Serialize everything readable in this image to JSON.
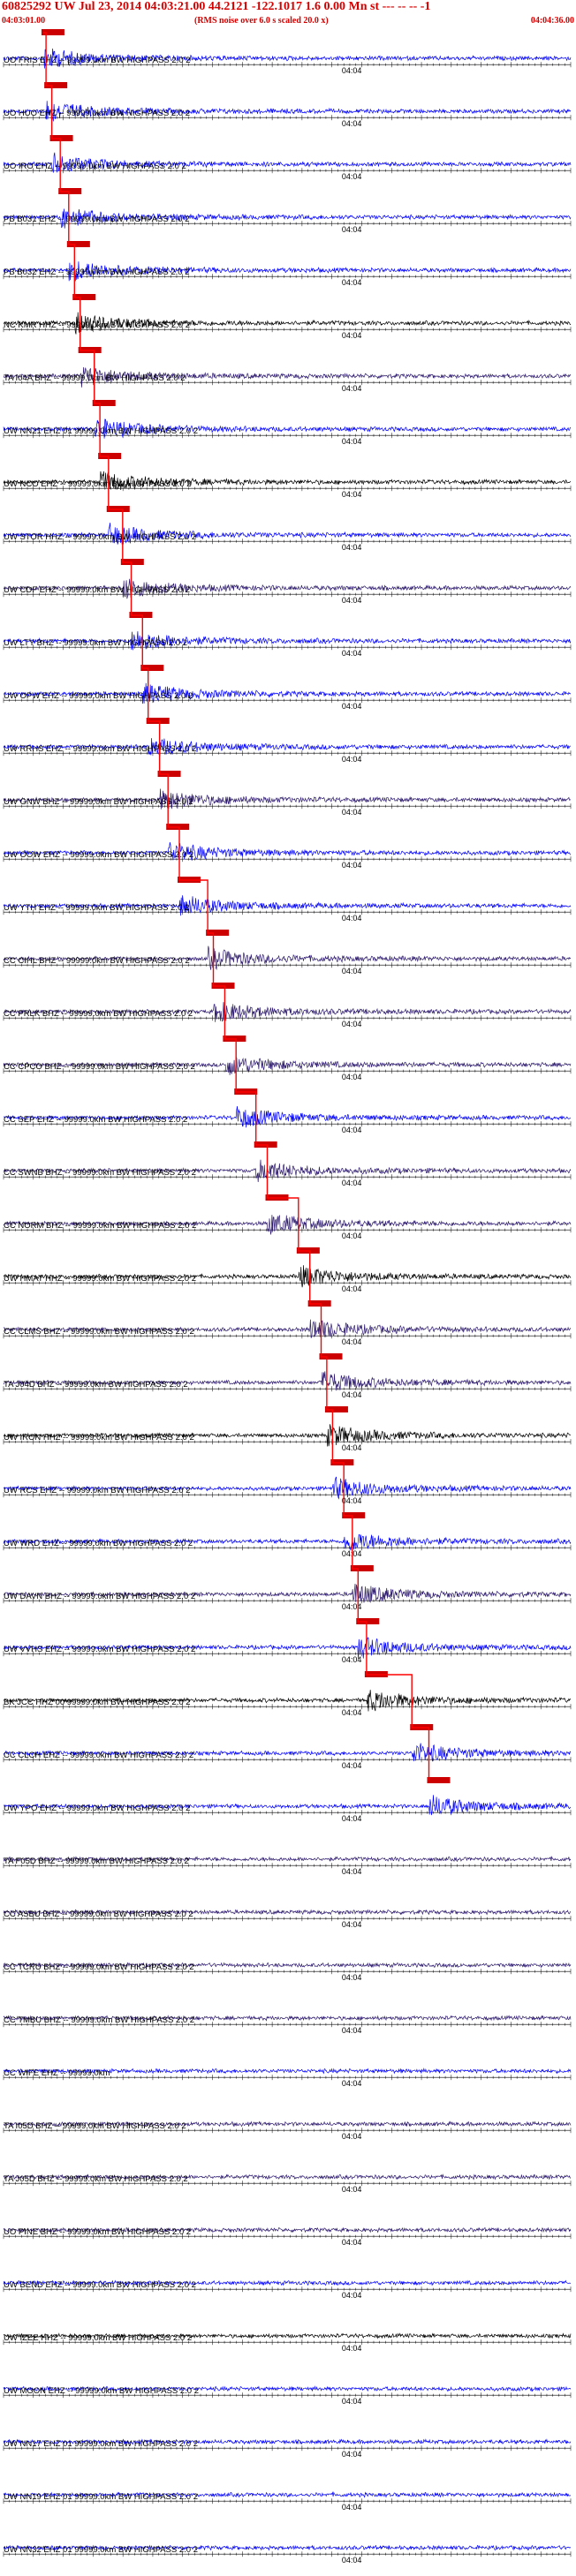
{
  "header": {
    "title": "60825292 UW Jul 23, 2014 04:03:21.00    44.2121 -122.1017  1.6 0.00 Mn st --- -- --   -1",
    "start_time": "04:03:01.00",
    "noise_note": "(RMS noise over 6.0 s scaled 20.0 x)",
    "end_time": "04:04:36.00"
  },
  "colors": {
    "blue_trace": "#0000ff",
    "black_trace": "#000000",
    "purple_trace": "#2d1a6e",
    "pick_marker": "#cc0000",
    "arrival_line": "#ff0000",
    "axis": "#000000"
  },
  "chart_data": {
    "type": "seismogram",
    "time_range": [
      "04:03:01.00",
      "04:04:36.00"
    ],
    "minute_tick_label": "04:04",
    "traces": [
      {
        "label": "UO FRIS EHZ -- 99999.0km BW  HIGHPASS  2.0  2",
        "color": "blue",
        "pick": 0.07
      },
      {
        "label": "UO HUO EHZ -- 99999.0km BW  HIGHPASS  2.0  2",
        "color": "blue",
        "pick": 0.075
      },
      {
        "label": "UO IRO EHZ -- 99999.0km BW  HIGHPASS  2.0  2",
        "color": "blue",
        "pick": 0.085
      },
      {
        "label": "PB B031 EHZ -- 99999.0km BW  HIGHPASS  2.0  2",
        "color": "blue",
        "pick": 0.1
      },
      {
        "label": "PB B032 EHZ -- 99999.0km BW  HIGHPASS  2.0  2",
        "color": "blue",
        "pick": 0.115
      },
      {
        "label": "NC KMR HHZ -- 99999.0km BW  HIGHPASS  2.0  2",
        "color": "black",
        "pick": 0.125
      },
      {
        "label": "TA I04A BHZ -- 99999.0km BW  HIGHPASS  2.0  2",
        "color": "purple",
        "pick": 0.135
      },
      {
        "label": "UW NN21 EHZ 01 99999.0km BW  HIGHPASS  2.0  2",
        "color": "blue",
        "pick": 0.16
      },
      {
        "label": "UW NCO EHZ -- 99999.0km BW  HIGHPASS  2.0  2",
        "color": "black",
        "pick": 0.17
      },
      {
        "label": "UW STOR HHZ -- 99999.0km BW  HIGHPASS  2.0  2",
        "color": "blue",
        "pick": 0.185
      },
      {
        "label": "UW CDF EHZ -- 99999.0km BW  HIGHPASS  2.0  2",
        "color": "purple",
        "pick": 0.21
      },
      {
        "label": "UW LTY BHZ -- 99999.0km BW  HIGHPASS  2.0  2",
        "color": "blue",
        "pick": 0.225
      },
      {
        "label": "UW OPW EHZ -- 99999.0km BW  HIGHPASS  2.0  2",
        "color": "blue",
        "pick": 0.245
      },
      {
        "label": "UW RRHS EHZ -- 99999.0km BW  HIGHPASS  2.0  2",
        "color": "blue",
        "pick": 0.255
      },
      {
        "label": "UW GNW BHZ -- 99999.0km BW  HIGHPASS  2.0  2",
        "color": "purple",
        "pick": 0.275
      },
      {
        "label": "UW OOW EHZ -- 99999.0km BW  HIGHPASS  2.0  2",
        "color": "blue",
        "pick": 0.29
      },
      {
        "label": "UW YTH EHZ -- 99999.0km BW  HIGHPASS  2.0  2",
        "color": "blue",
        "pick": 0.31
      },
      {
        "label": "CC CIHL BHZ -- 99999.0km BW  HIGHPASS  2.0  2",
        "color": "purple",
        "pick": 0.36
      },
      {
        "label": "CC PRLK BHZ -- 99999.0km BW  HIGHPASS  2.0  2",
        "color": "purple",
        "pick": 0.37
      },
      {
        "label": "CC CPCO BHZ -- 99999.0km BW  HIGHPASS  2.0  2",
        "color": "purple",
        "pick": 0.39
      },
      {
        "label": "CC SEP EHZ -- 99999.0km BW  HIGHPASS  2.0  2",
        "color": "blue",
        "pick": 0.41
      },
      {
        "label": "CC SWNB BHZ -- 99999.0km BW  HIGHPASS  2.0  2",
        "color": "purple",
        "pick": 0.445
      },
      {
        "label": "CC NORM BHZ -- 99999.0km BW  HIGHPASS  2.0  2",
        "color": "purple",
        "pick": 0.465
      },
      {
        "label": "UW HMAT HHZ -- 99999.0km BW  HIGHPASS  2.0  2",
        "color": "black",
        "pick": 0.52
      },
      {
        "label": "CC CLMS BHZ -- 99999.0km BW  HIGHPASS  2.0  2",
        "color": "purple",
        "pick": 0.54
      },
      {
        "label": "TA J04D BHZ -- 99999.0km BW  HIGHPASS  2.0  2",
        "color": "purple",
        "pick": 0.56
      },
      {
        "label": "UW IRON HHZ -- 99999.0km BW  HIGHPASS  2.0  2",
        "color": "black",
        "pick": 0.57
      },
      {
        "label": "UW RCS EHZ -- 99999.0km BW  HIGHPASS  2.0  2",
        "color": "blue",
        "pick": 0.58
      },
      {
        "label": "UW WRD EHZ -- 99999.0km BW  HIGHPASS  2.0  2",
        "color": "blue",
        "pick": 0.6
      },
      {
        "label": "UW DAVN BHZ -- 99999.0km BW  HIGHPASS  2.0  2",
        "color": "purple",
        "pick": 0.615
      },
      {
        "label": "UW VVHS EHZ -- 99999.0km BW  HIGHPASS  2.0  2",
        "color": "blue",
        "pick": 0.625
      },
      {
        "label": "BK JCC HHZ 00 99999.0km BW  HIGHPASS  2.0  2",
        "color": "black",
        "pick": 0.64
      },
      {
        "label": "CC CLCH EHZ -- 99999.0km BW  HIGHPASS  2.0  2",
        "color": "blue",
        "pick": 0.72
      },
      {
        "label": "UW YPO EHZ -- 99999.0km BW  HIGHPASS  2.0  2",
        "color": "blue",
        "pick": 0.75
      },
      {
        "label": "TA F05D BHZ -- 99999.0km BW  HIGHPASS  2.0  2",
        "color": "purple",
        "pick": null
      },
      {
        "label": "CC ASBU BHZ -- 99999.0km BW  HIGHPASS  2.0  2",
        "color": "purple",
        "pick": null
      },
      {
        "label": "CC TCRU BHZ -- 99999.0km BW  HIGHPASS  2.0  2",
        "color": "purple",
        "pick": null
      },
      {
        "label": "CC TMBU BHZ -- 99999.0km BW  HIGHPASS  2.0  2",
        "color": "purple",
        "pick": null
      },
      {
        "label": "CC WIFE EHZ -- 99999.0km",
        "color": "blue",
        "pick": null
      },
      {
        "label": "TA I05D BHZ -- 99999.0km BW  HIGHPASS  2.0  2",
        "color": "purple",
        "pick": null
      },
      {
        "label": "TA J05D BHZ -- 99999.0km BW  HIGHPASS  2.0  2",
        "color": "purple",
        "pick": null
      },
      {
        "label": "UO PINE BHZ -- 99999.0km BW  HIGHPASS  2.0  2",
        "color": "purple",
        "pick": null
      },
      {
        "label": "UW BEND EHZ -- 99999.0km BW  HIGHPASS  2.0  2",
        "color": "blue",
        "pick": null
      },
      {
        "label": "UW IZEE HHZ -- 99999.0km BW  HIGHPASS  2.0  2",
        "color": "black",
        "pick": null
      },
      {
        "label": "UW MOON EHZ -- 99999.0km BW  HIGHPASS  2.0  2",
        "color": "blue",
        "pick": null
      },
      {
        "label": "UW NN17 EHZ 01 99999.0km BW  HIGHPASS  2.0  2",
        "color": "blue",
        "pick": null
      },
      {
        "label": "UW NN19 EHZ 01 99999.0km BW  HIGHPASS  2.0  2",
        "color": "blue",
        "pick": null
      },
      {
        "label": "UW NN32 EHZ 01 99999.0km BW  HIGHPASS  2.0  2",
        "color": "blue",
        "pick": null
      }
    ]
  }
}
